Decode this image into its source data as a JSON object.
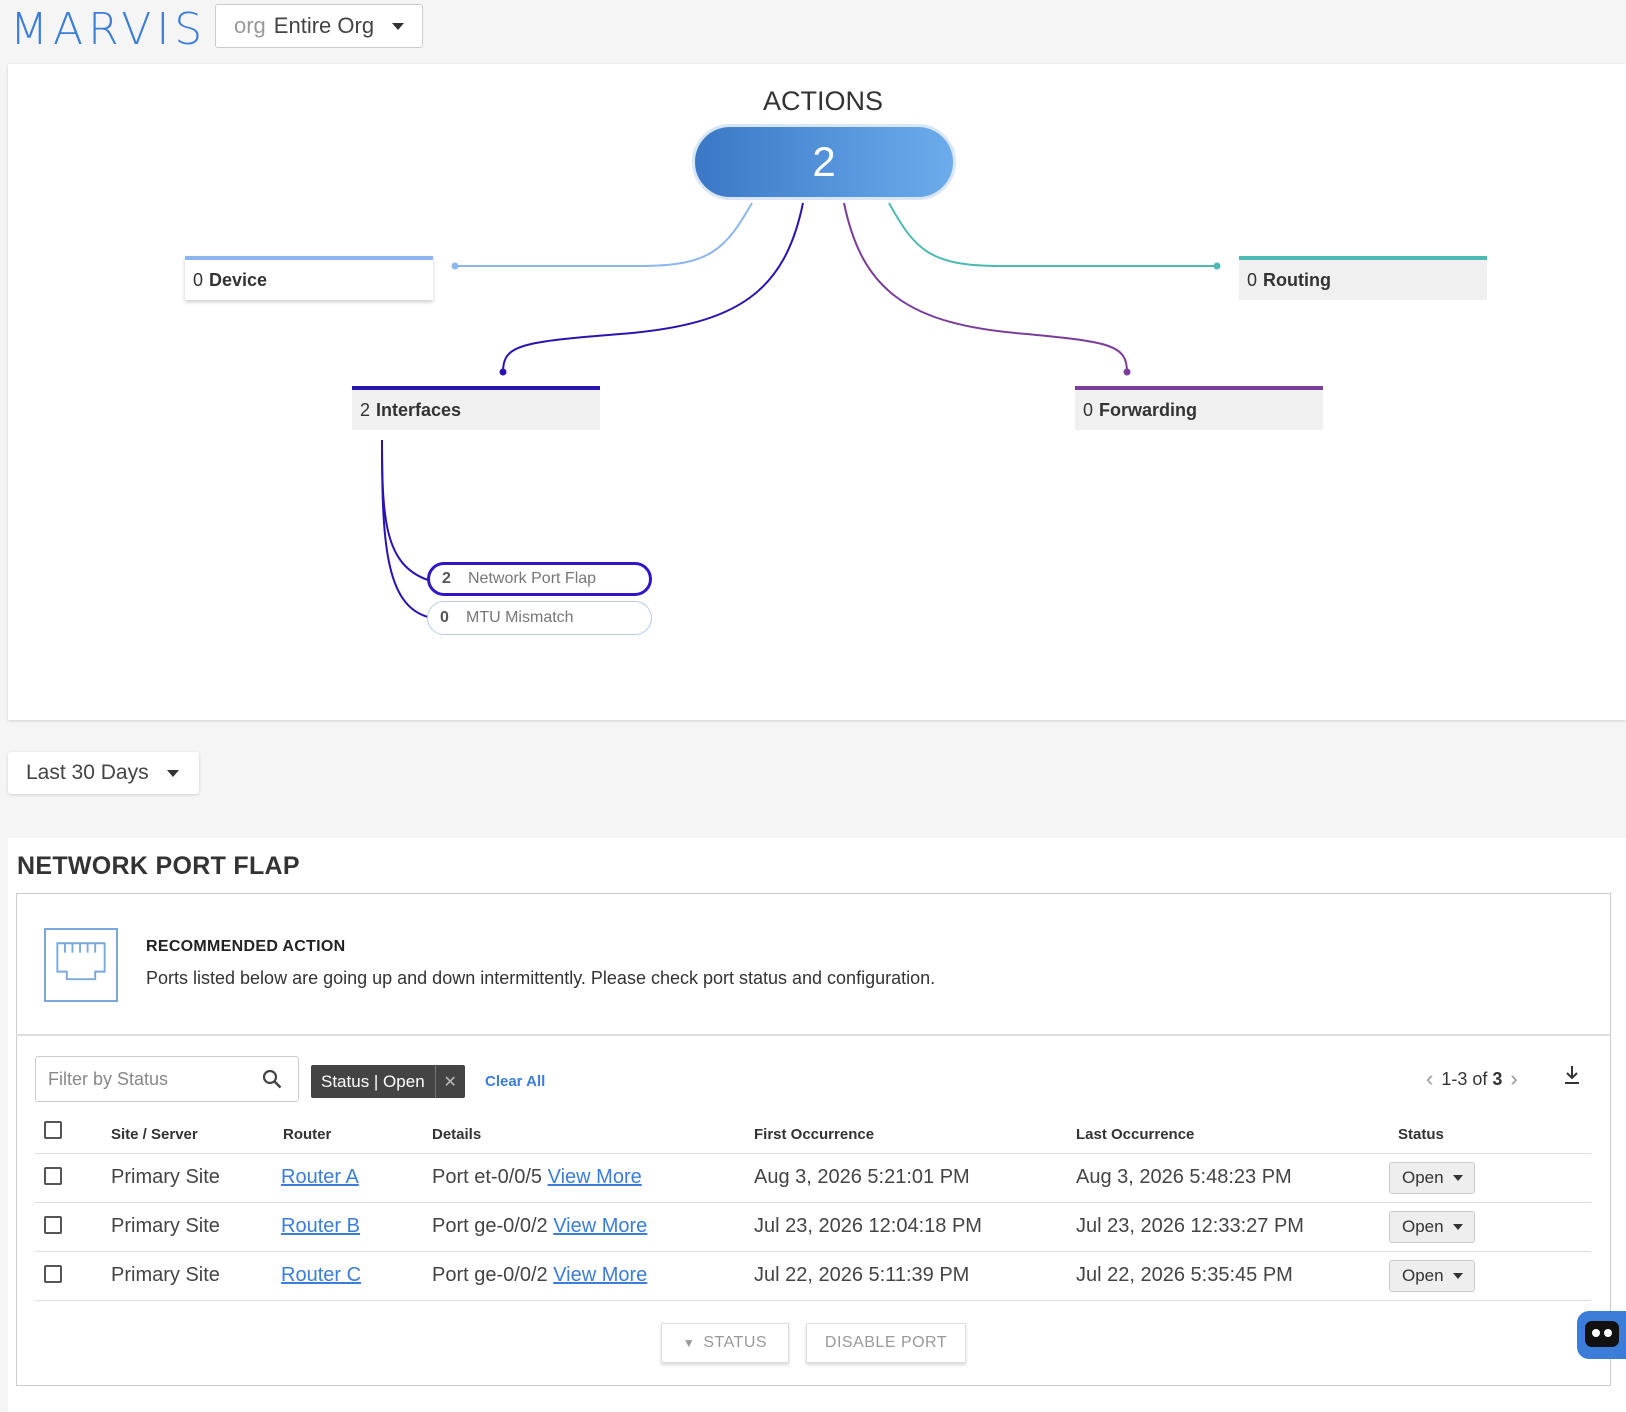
{
  "header": {
    "logo": "MARVIS",
    "org_prefix": "org",
    "org_value": "Entire Org"
  },
  "actions": {
    "title": "ACTIONS",
    "total": "2",
    "categories": {
      "device": {
        "count": "0",
        "label": "Device",
        "color": "#8db5ee"
      },
      "routing": {
        "count": "0",
        "label": "Routing",
        "color": "#4cb9b2"
      },
      "interfaces": {
        "count": "2",
        "label": "Interfaces",
        "color": "#2a14b0"
      },
      "forwarding": {
        "count": "0",
        "label": "Forwarding",
        "color": "#7a3d9a"
      }
    },
    "sub_items": [
      {
        "count": "2",
        "label": "Network Port Flap"
      },
      {
        "count": "0",
        "label": "MTU Mismatch"
      }
    ]
  },
  "time_range": "Last 30 Days",
  "detail": {
    "title": "NETWORK PORT FLAP",
    "recommended_title": "RECOMMENDED ACTION",
    "recommended_text": "Ports listed below are going up and down intermittently. Please check port status and configuration.",
    "filter_placeholder": "Filter by Status",
    "chip_label": "Status | Open",
    "clear_all": "Clear All",
    "pager": {
      "range": "1-3 of",
      "total": "3"
    },
    "columns": [
      "Site / Server",
      "Router",
      "Details",
      "First Occurrence",
      "Last Occurrence",
      "Status"
    ],
    "rows": [
      {
        "site": "Primary Site",
        "router": "Router A",
        "details": "Port et-0/0/5",
        "view_more": "View More",
        "first": "Aug 3, 2026 5:21:01 PM",
        "last": "Aug 3, 2026 5:48:23 PM",
        "status": "Open"
      },
      {
        "site": "Primary Site",
        "router": "Router B",
        "details": "Port ge-0/0/2",
        "view_more": "View More",
        "first": "Jul 23, 2026 12:04:18 PM",
        "last": "Jul 23, 2026 12:33:27 PM",
        "status": "Open"
      },
      {
        "site": "Primary Site",
        "router": "Router C",
        "details": "Port ge-0/0/2",
        "view_more": "View More",
        "first": "Jul 22, 2026 5:11:39 PM",
        "last": "Jul 22, 2026 5:35:45 PM",
        "status": "Open"
      }
    ],
    "bulk_status": "STATUS",
    "disable_port": "DISABLE PORT"
  }
}
